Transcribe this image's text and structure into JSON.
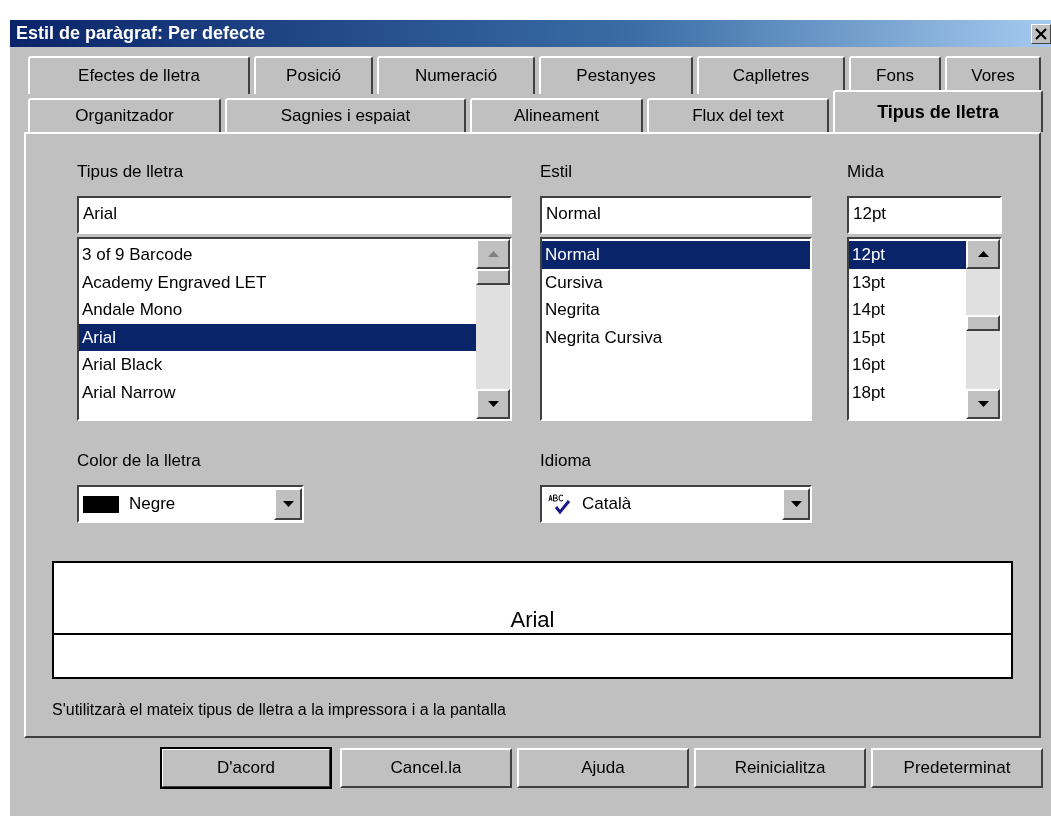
{
  "window": {
    "title": "Estil de paràgraf: Per defecte"
  },
  "tab_rows": [
    [
      {
        "label": "Efectes de lletra",
        "selected": false
      },
      {
        "label": "Posició",
        "selected": false
      },
      {
        "label": "Numeració",
        "selected": false
      },
      {
        "label": "Pestanyes",
        "selected": false
      },
      {
        "label": "Caplletres",
        "selected": false
      },
      {
        "label": "Fons",
        "selected": false
      },
      {
        "label": "Vores",
        "selected": false
      }
    ],
    [
      {
        "label": "Organitzador",
        "selected": false
      },
      {
        "label": "Sagnies i espaiat",
        "selected": false
      },
      {
        "label": "Alineament",
        "selected": false
      },
      {
        "label": "Flux del text",
        "selected": false
      },
      {
        "label": "Tipus de lletra",
        "selected": true
      }
    ]
  ],
  "font": {
    "label": "Tipus de lletra",
    "value": "Arial",
    "items": [
      {
        "label": "3 of 9 Barcode",
        "selected": false
      },
      {
        "label": "Academy Engraved LET",
        "selected": false
      },
      {
        "label": "Andale Mono",
        "selected": false
      },
      {
        "label": "Arial",
        "selected": true
      },
      {
        "label": "Arial Black",
        "selected": false
      },
      {
        "label": "Arial Narrow",
        "selected": false
      }
    ]
  },
  "style": {
    "label": "Estil",
    "value": "Normal",
    "items": [
      {
        "label": "Normal",
        "selected": true
      },
      {
        "label": "Cursiva",
        "selected": false
      },
      {
        "label": "Negrita",
        "selected": false
      },
      {
        "label": "Negrita Cursiva",
        "selected": false
      }
    ]
  },
  "size": {
    "label": "Mida",
    "value": "12pt",
    "items": [
      {
        "label": "12pt",
        "selected": true
      },
      {
        "label": "13pt",
        "selected": false
      },
      {
        "label": "14pt",
        "selected": false
      },
      {
        "label": "15pt",
        "selected": false
      },
      {
        "label": "16pt",
        "selected": false
      },
      {
        "label": "18pt",
        "selected": false
      }
    ]
  },
  "font_color": {
    "label": "Color de la lletra",
    "value": "Negre"
  },
  "language": {
    "label": "Idioma",
    "value": "Català"
  },
  "preview": {
    "text": "Arial"
  },
  "note": "S'utilitzarà el mateix tipus de lletra a la impressora i a la pantalla",
  "buttons": [
    {
      "label": "D'acord",
      "default": true
    },
    {
      "label": "Cancel.la",
      "default": false
    },
    {
      "label": "Ajuda",
      "default": false
    },
    {
      "label": "Reinicialitza",
      "default": false
    },
    {
      "label": "Predeterminat",
      "default": false
    }
  ]
}
